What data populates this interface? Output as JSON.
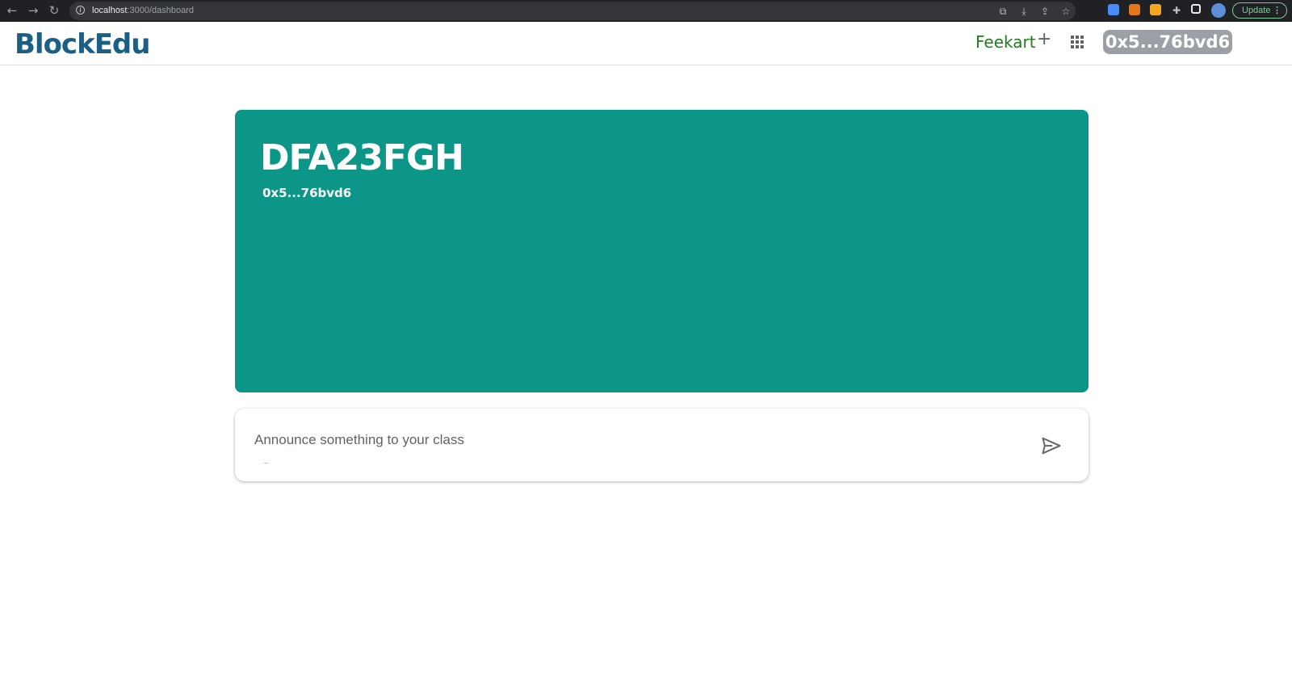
{
  "browser": {
    "url_host": "localhost",
    "url_rest": ":3000/dashboard",
    "update_label": "Update"
  },
  "header": {
    "logo": "BlockEdu",
    "nav_link": "Feekart",
    "plus_glyph": "+",
    "wallet": "0x5...76bvd6"
  },
  "banner": {
    "class_code": "DFA23FGH",
    "owner": "0x5...76bvd6",
    "color": "#0b9688"
  },
  "announce": {
    "placeholder": "Announce something to your class",
    "value": ""
  },
  "icons": {
    "back": "arrow-left",
    "forward": "arrow-right",
    "reload": "reload",
    "send": "send"
  }
}
